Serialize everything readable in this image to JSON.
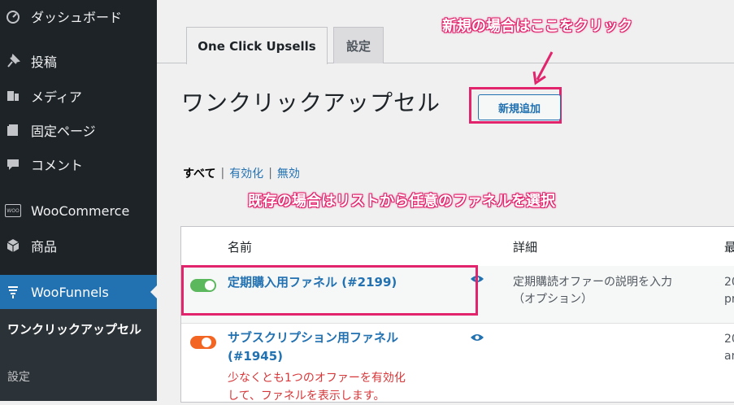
{
  "sidebar": {
    "items": [
      {
        "label": "ダッシュボード",
        "icon": "dashboard-icon"
      },
      {
        "label": "投稿",
        "icon": "pin-icon"
      },
      {
        "label": "メディア",
        "icon": "media-icon"
      },
      {
        "label": "固定ページ",
        "icon": "page-icon"
      },
      {
        "label": "コメント",
        "icon": "comment-icon"
      },
      {
        "label": "WooCommerce",
        "icon": "woo-icon",
        "badge": "WOO"
      },
      {
        "label": "商品",
        "icon": "box-icon"
      },
      {
        "label": "WooFunnels",
        "icon": "funnel-icon"
      }
    ],
    "submenu": {
      "current": "ワンクリックアップセル",
      "item": "設定"
    }
  },
  "tabs": [
    {
      "label": "One Click Upsells"
    },
    {
      "label": "設定"
    }
  ],
  "heading": "ワンクリックアップセル",
  "add_button": "新規追加",
  "filters": {
    "all": "すべて",
    "enabled": "有効化",
    "disabled": "無効"
  },
  "annotations": {
    "new": "新規の場合はここをクリック",
    "existing": "既存の場合はリストから任意のファネルを選択"
  },
  "table": {
    "headers": [
      "名前",
      "詳細",
      "最"
    ],
    "rows": [
      {
        "name": "定期購入用ファネル (#2199)",
        "status": "on",
        "detail_line1": "定期購読オファーの説明を入力",
        "detail_line2": "（オプション）",
        "last_line1": "20",
        "last_line2": "pr"
      },
      {
        "name_line1": "サブスクリプション用ファネル",
        "name_line2": "(#1945)",
        "status": "off",
        "warning_line1": "少なくとも1つのオファーを有効化",
        "warning_line2": "して、ファネルを表示します。",
        "last_line1": "20",
        "last_line2": "an"
      }
    ]
  },
  "colors": {
    "sidebar_bg": "#1d2327",
    "active_menu": "#2271b1",
    "highlight": "#e2246d",
    "toggle_on": "#5cb85c",
    "toggle_off": "#f26522",
    "link": "#2271b1"
  }
}
